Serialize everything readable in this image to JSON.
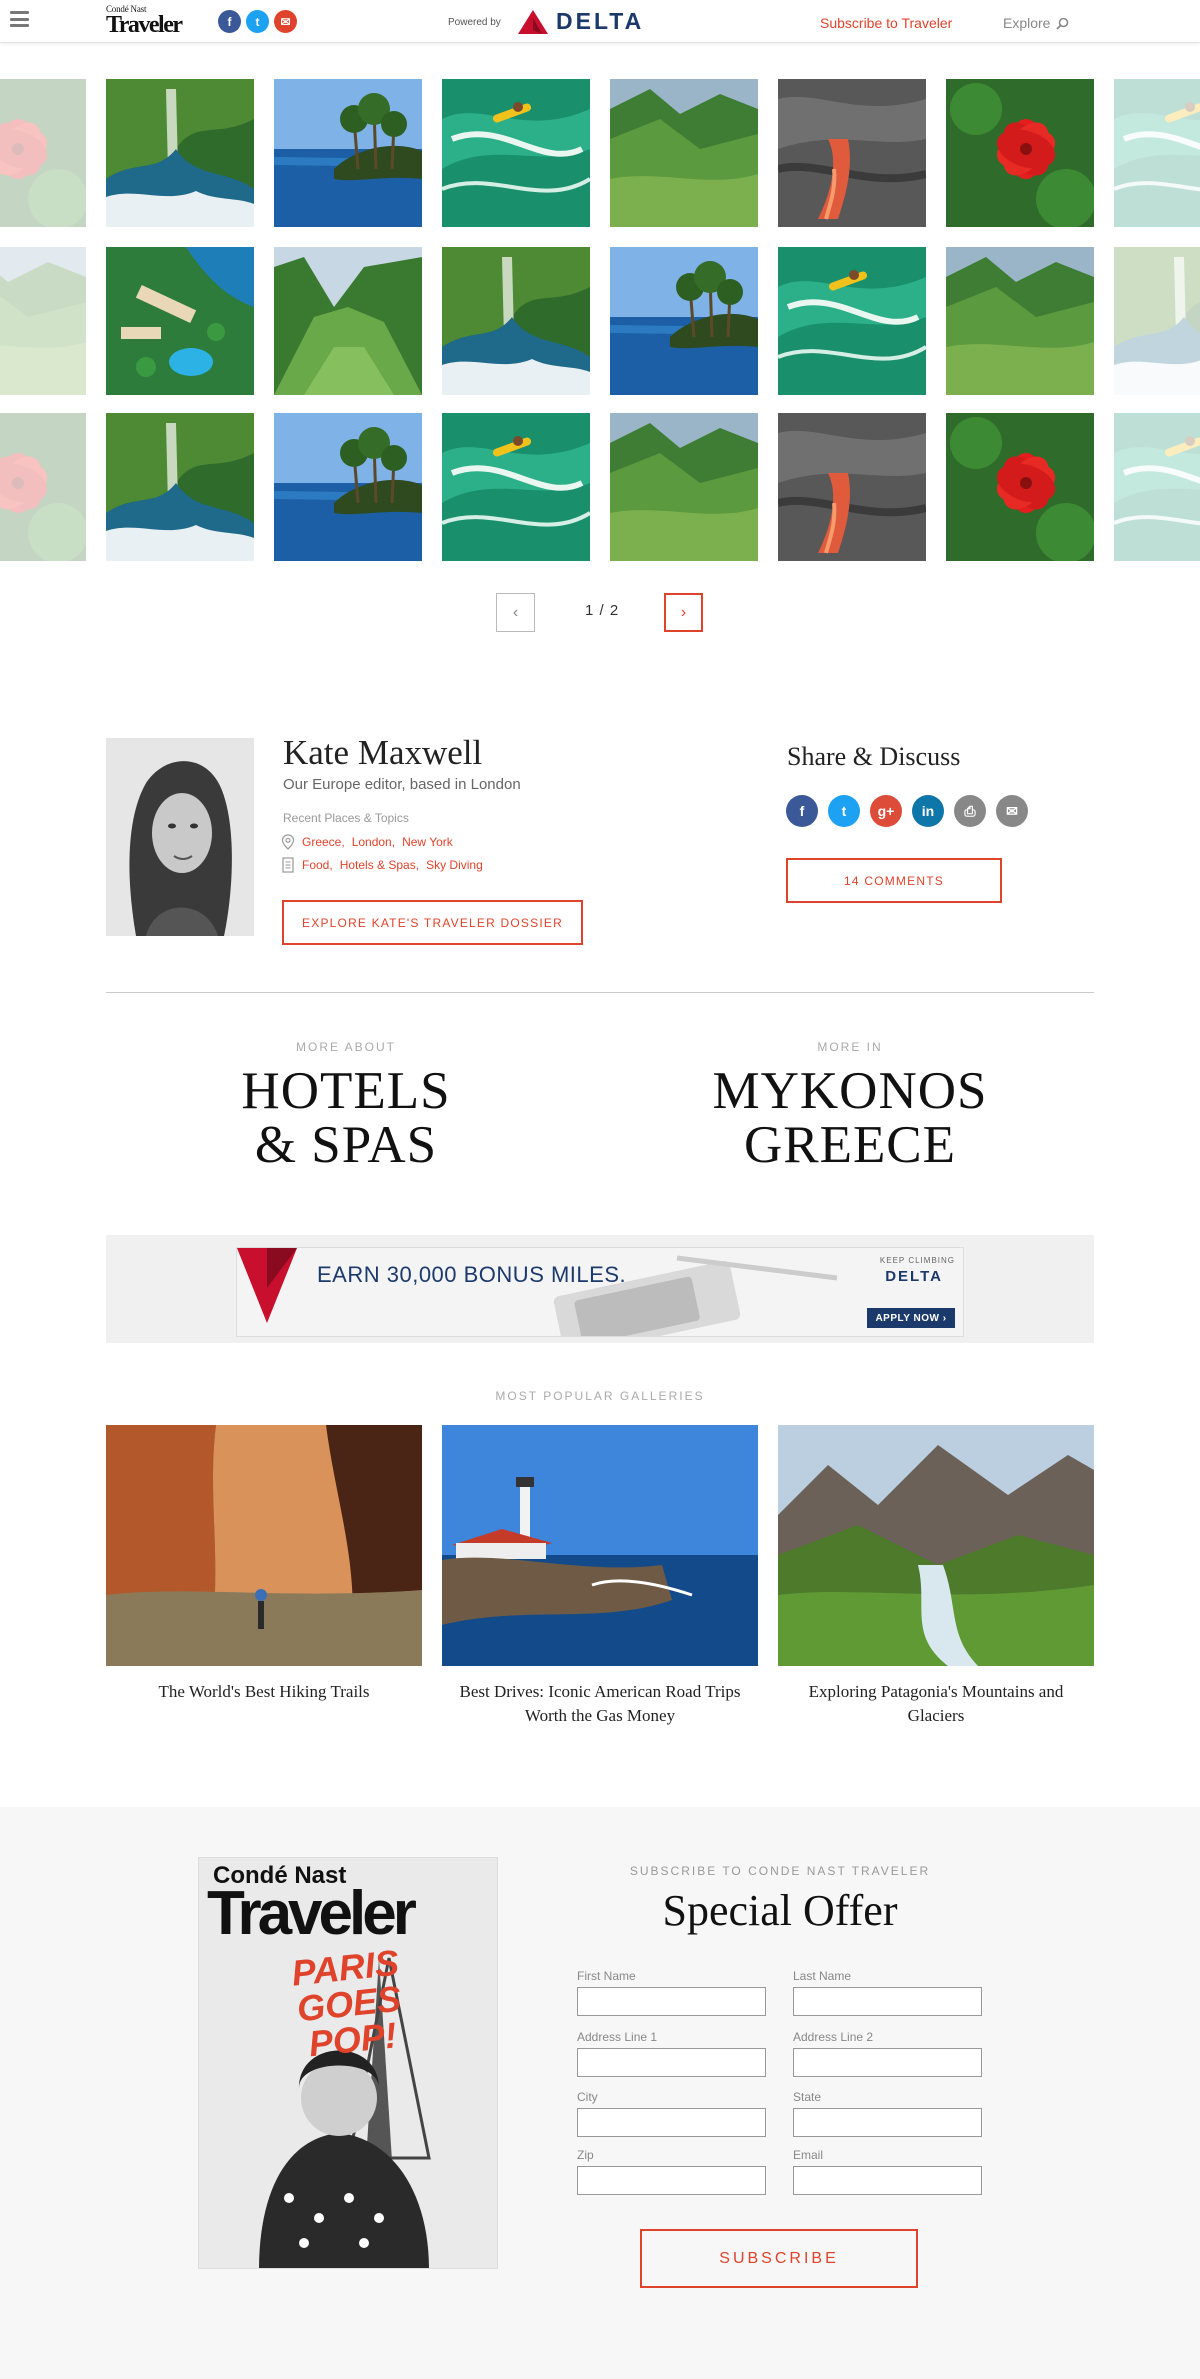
{
  "header": {
    "logo_small": "Condé Nast",
    "logo_big": "Traveler",
    "social": [
      "f",
      "t",
      "✉"
    ],
    "powered_by": "Powered by",
    "sponsor": "DELTA",
    "subscribe_link": "Subscribe to Traveler",
    "explore": "Explore"
  },
  "pager": {
    "count": "1 / 2",
    "prev": "‹",
    "next": "›"
  },
  "author": {
    "name": "Kate Maxwell",
    "bio": "Our Europe editor, based in London",
    "recent_label": "Recent Places & Topics",
    "places": [
      "Greece,",
      "London,",
      "New York"
    ],
    "topics": [
      "Food,",
      "Hotels & Spas,",
      "Sky Diving"
    ],
    "dossier_button": "EXPLORE KATE'S TRAVELER DOSSIER"
  },
  "share": {
    "title": "Share & Discuss",
    "icons": [
      "f",
      "t",
      "g+",
      "in",
      "⎙",
      "✉"
    ],
    "comments_button": "14 COMMENTS"
  },
  "more": {
    "about_kicker": "MORE ABOUT",
    "about_line1": "HOTELS",
    "about_line2": "& SPAS",
    "in_kicker": "MORE IN",
    "in_line1": "MYKONOS",
    "in_line2": "GREECE"
  },
  "ad": {
    "headline": "EARN 30,000 BONUS MILES.",
    "tagline": "KEEP CLIMBING",
    "brand": "DELTA",
    "cta": "APPLY NOW ›"
  },
  "popular": {
    "label": "MOST POPULAR GALLERIES",
    "items": [
      {
        "title": "The World's Best Hiking Trails"
      },
      {
        "title": "Best Drives: Iconic American Road Trips Worth the Gas Money"
      },
      {
        "title": "Exploring Patagonia's Mountains and Glaciers"
      }
    ]
  },
  "subscribe": {
    "kicker": "SUBSCRIBE TO CONDE NAST TRAVELER",
    "title": "Special Offer",
    "cover_brand_small": "Condé Nast",
    "cover_brand_big": "Traveler",
    "cover_headline": "PARIS GOES POP!",
    "fields": {
      "first_name": {
        "label": "First Name",
        "value": ""
      },
      "last_name": {
        "label": "Last Name",
        "value": ""
      },
      "address1": {
        "label": "Address Line 1",
        "value": ""
      },
      "address2": {
        "label": "Address Line 2",
        "value": ""
      },
      "city": {
        "label": "City",
        "value": ""
      },
      "state": {
        "label": "State",
        "value": ""
      },
      "zip": {
        "label": "Zip",
        "value": ""
      },
      "email": {
        "label": "Email",
        "value": ""
      }
    },
    "button": "SUBSCRIBE"
  },
  "colors": {
    "accent": "#e0432c",
    "delta_navy": "#1b3a6b",
    "facebook": "#3b5998",
    "twitter": "#1da1f2",
    "gplus": "#dd4b39",
    "linkedin": "#0e76a8",
    "print": "#888888",
    "email": "#888888"
  }
}
